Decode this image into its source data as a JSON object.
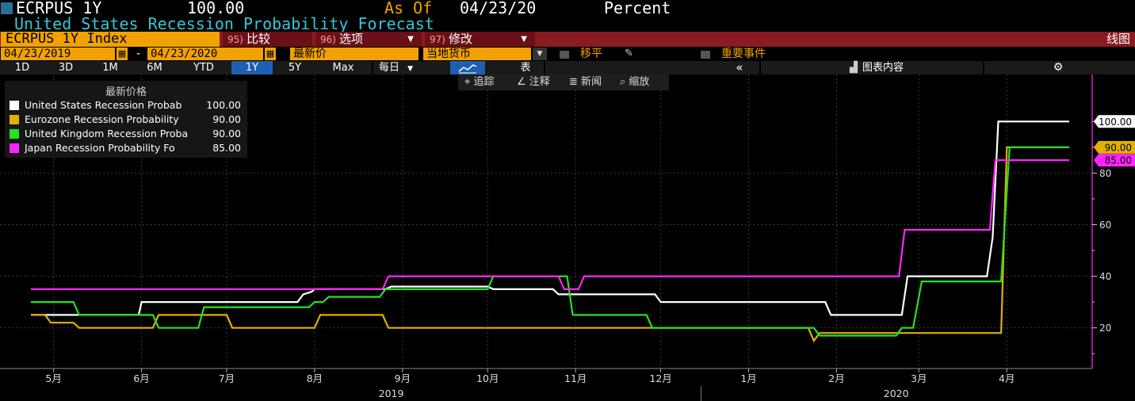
{
  "header": {
    "ticker": "ECRPUS 1Y",
    "last_value": "100.00",
    "as_of_label": "As Of",
    "as_of_date": "04/23/20",
    "units": "Percent",
    "subtitle": "United States Recession Probability Forecast"
  },
  "menu": {
    "index_name": "ECRPUS 1Y Index",
    "compare_num": "95)",
    "compare_label": "比较",
    "options_num": "96)",
    "options_label": "选项",
    "modify_num": "97)",
    "modify_label": "修改",
    "chart_type_label": "线图"
  },
  "controls": {
    "start_date": "04/23/2019",
    "date_sep": "-",
    "end_date": "04/23/2020",
    "price_field": "最新价",
    "currency_field": "当地货币",
    "shift_label": "移平",
    "events_label": "重要事件",
    "ranges": [
      "1D",
      "3D",
      "1M",
      "6M",
      "YTD",
      "1Y",
      "5Y",
      "Max"
    ],
    "active_range": "1Y",
    "frequency": "每日",
    "table_label": "表",
    "collapse_label": "«",
    "chart_content_label": "图表内容",
    "settings_icon": "gear-icon"
  },
  "tools": {
    "track_label": "追踪",
    "annotate_label": "注释",
    "news_label": "新闻",
    "zoom_label": "缩放"
  },
  "legend": {
    "title": "最新价格",
    "items": [
      {
        "name": "United States Recession Probab",
        "value": "100.00",
        "color": "#ffffff"
      },
      {
        "name": "Eurozone Recession Probability",
        "value": "90.00",
        "color": "#e0b100"
      },
      {
        "name": "United Kingdom Recession Proba",
        "value": "90.00",
        "color": "#22e222"
      },
      {
        "name": "Japan Recession Probability Fo",
        "value": "85.00",
        "color": "#ff24ff"
      }
    ]
  },
  "chart_data": {
    "type": "line",
    "title": "United States Recession Probability Forecast",
    "ylabel": "Percent",
    "ylim": [
      7,
      109
    ],
    "yticks": [
      20,
      40,
      60,
      80
    ],
    "ytick_labels": [
      "20",
      "40",
      "60",
      "80"
    ],
    "x_range": [
      "2019-04-23",
      "2020-04-23"
    ],
    "x_month_labels": [
      {
        "date": "2019-04-01",
        "label": "4月"
      },
      {
        "date": "2019-05-01",
        "label": "5月"
      },
      {
        "date": "2019-06-01",
        "label": "6月"
      },
      {
        "date": "2019-07-01",
        "label": "7月"
      },
      {
        "date": "2019-08-01",
        "label": "8月"
      },
      {
        "date": "2019-09-01",
        "label": "9月"
      },
      {
        "date": "2019-10-01",
        "label": "10月"
      },
      {
        "date": "2019-11-01",
        "label": "11月"
      },
      {
        "date": "2019-12-01",
        "label": "12月"
      },
      {
        "date": "2020-01-01",
        "label": "1月"
      },
      {
        "date": "2020-02-01",
        "label": "2月"
      },
      {
        "date": "2020-03-01",
        "label": "3月"
      },
      {
        "date": "2020-04-01",
        "label": "4月"
      }
    ],
    "x_year_labels": [
      {
        "date": "2019-08-28",
        "label": "2019"
      },
      {
        "date": "2020-02-22",
        "label": "2020"
      }
    ],
    "year_divider": "2020-01-01",
    "grid": true,
    "legend_position": "top-left",
    "last_value_labels": [
      {
        "value": 100,
        "label": "100.00",
        "color": "#ffffff"
      },
      {
        "value": 90,
        "label": "90.00",
        "color": "#e0b100"
      },
      {
        "value": 85,
        "label": "85.00",
        "color": "#ff24ff"
      }
    ],
    "series": [
      {
        "name": "United States Recession Probab",
        "color": "#ffffff",
        "points": [
          [
            "2019-04-23",
            25
          ],
          [
            "2019-05-31",
            25
          ],
          [
            "2019-06-01",
            30
          ],
          [
            "2019-07-26",
            30
          ],
          [
            "2019-07-28",
            33
          ],
          [
            "2019-07-31",
            34
          ],
          [
            "2019-08-01",
            35
          ],
          [
            "2019-08-26",
            35
          ],
          [
            "2019-08-28",
            36
          ],
          [
            "2019-10-01",
            36
          ],
          [
            "2019-10-03",
            35
          ],
          [
            "2019-10-24",
            35
          ],
          [
            "2019-10-26",
            33
          ],
          [
            "2019-11-29",
            33
          ],
          [
            "2019-12-01",
            30
          ],
          [
            "2020-01-28",
            30
          ],
          [
            "2020-01-30",
            25
          ],
          [
            "2020-02-24",
            25
          ],
          [
            "2020-02-26",
            40
          ],
          [
            "2020-03-25",
            40
          ],
          [
            "2020-03-27",
            55
          ],
          [
            "2020-03-29",
            100
          ],
          [
            "2020-04-23",
            100
          ]
        ]
      },
      {
        "name": "Eurozone Recession Probability",
        "color": "#e0b100",
        "points": [
          [
            "2019-04-23",
            25
          ],
          [
            "2019-04-28",
            25
          ],
          [
            "2019-04-30",
            22
          ],
          [
            "2019-05-08",
            22
          ],
          [
            "2019-05-10",
            20
          ],
          [
            "2019-06-05",
            20
          ],
          [
            "2019-06-07",
            25
          ],
          [
            "2019-07-01",
            25
          ],
          [
            "2019-07-03",
            20
          ],
          [
            "2019-08-01",
            20
          ],
          [
            "2019-08-03",
            25
          ],
          [
            "2019-08-25",
            25
          ],
          [
            "2019-08-27",
            20
          ],
          [
            "2020-01-22",
            20
          ],
          [
            "2020-01-24",
            15
          ],
          [
            "2020-01-26",
            18
          ],
          [
            "2020-03-30",
            18
          ],
          [
            "2020-04-01",
            90
          ],
          [
            "2020-04-23",
            90
          ]
        ]
      },
      {
        "name": "United Kingdom Recession Proba",
        "color": "#22e222",
        "points": [
          [
            "2019-04-23",
            30
          ],
          [
            "2019-05-08",
            30
          ],
          [
            "2019-05-10",
            25
          ],
          [
            "2019-06-05",
            25
          ],
          [
            "2019-06-07",
            20
          ],
          [
            "2019-06-21",
            20
          ],
          [
            "2019-06-23",
            28
          ],
          [
            "2019-07-30",
            28
          ],
          [
            "2019-08-01",
            30
          ],
          [
            "2019-08-04",
            30
          ],
          [
            "2019-08-06",
            32
          ],
          [
            "2019-08-24",
            32
          ],
          [
            "2019-08-26",
            35
          ],
          [
            "2019-10-01",
            35
          ],
          [
            "2019-10-03",
            40
          ],
          [
            "2019-10-29",
            40
          ],
          [
            "2019-10-31",
            25
          ],
          [
            "2019-11-26",
            25
          ],
          [
            "2019-11-28",
            20
          ],
          [
            "2020-01-24",
            20
          ],
          [
            "2020-01-26",
            17
          ],
          [
            "2020-02-22",
            17
          ],
          [
            "2020-02-24",
            20
          ],
          [
            "2020-02-28",
            20
          ],
          [
            "2020-03-02",
            38
          ],
          [
            "2020-03-30",
            38
          ],
          [
            "2020-04-02",
            90
          ],
          [
            "2020-04-23",
            90
          ]
        ]
      },
      {
        "name": "Japan Recession Probability Fo",
        "color": "#ff24ff",
        "points": [
          [
            "2019-04-23",
            35
          ],
          [
            "2019-08-25",
            35
          ],
          [
            "2019-08-27",
            40
          ],
          [
            "2019-10-26",
            40
          ],
          [
            "2019-10-28",
            35
          ],
          [
            "2019-11-02",
            35
          ],
          [
            "2019-11-04",
            40
          ],
          [
            "2020-02-23",
            40
          ],
          [
            "2020-02-25",
            58
          ],
          [
            "2020-03-26",
            58
          ],
          [
            "2020-03-28",
            85
          ],
          [
            "2020-04-23",
            85
          ]
        ]
      }
    ]
  }
}
